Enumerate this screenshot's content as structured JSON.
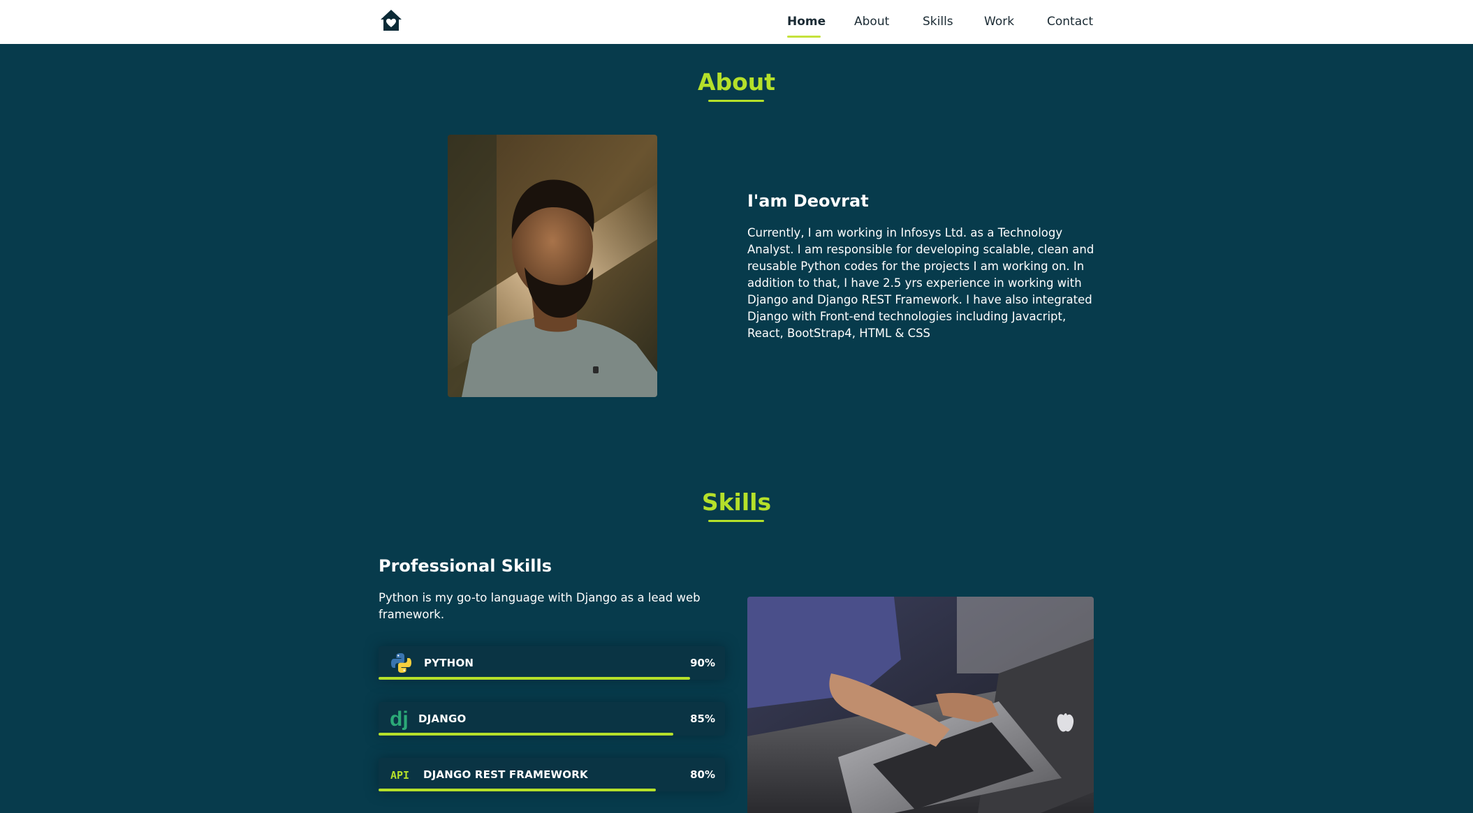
{
  "nav": {
    "items": [
      {
        "label": "Home",
        "active": true
      },
      {
        "label": "About",
        "active": false
      },
      {
        "label": "Skills",
        "active": false
      },
      {
        "label": "Work",
        "active": false
      },
      {
        "label": "Contact",
        "active": false
      }
    ],
    "logo_icon": "home-heart-icon"
  },
  "about": {
    "title": "About",
    "heading": "I'am Deovrat",
    "description": "Currently, I am working in Infosys Ltd. as a Technology Analyst. I am responsible for developing scalable, clean and reusable Python codes for the projects I am working on. In addition to that, I have 2.5 yrs experience in working with Django and Django REST Framework. I have also integrated Django with Front-end technologies including Javacript, React, BootStrap4, HTML & CSS"
  },
  "skills": {
    "title": "Skills",
    "heading": "Professional Skills",
    "description": "Python is my go-to language with Django as a lead web framework.",
    "items": [
      {
        "name": "PYTHON",
        "percent_label": "90%",
        "level": 0.9,
        "icon": "python-icon"
      },
      {
        "name": "DJANGO",
        "percent_label": "85%",
        "level": 0.85,
        "icon": "django-icon",
        "icon_text": "dj"
      },
      {
        "name": "DJANGO REST FRAMEWORK",
        "percent_label": "80%",
        "level": 0.8,
        "icon": "api-icon",
        "icon_text": "API"
      }
    ]
  },
  "colors": {
    "background": "#073b4c",
    "accent": "#b5e02a",
    "header_bg": "#ffffff"
  }
}
